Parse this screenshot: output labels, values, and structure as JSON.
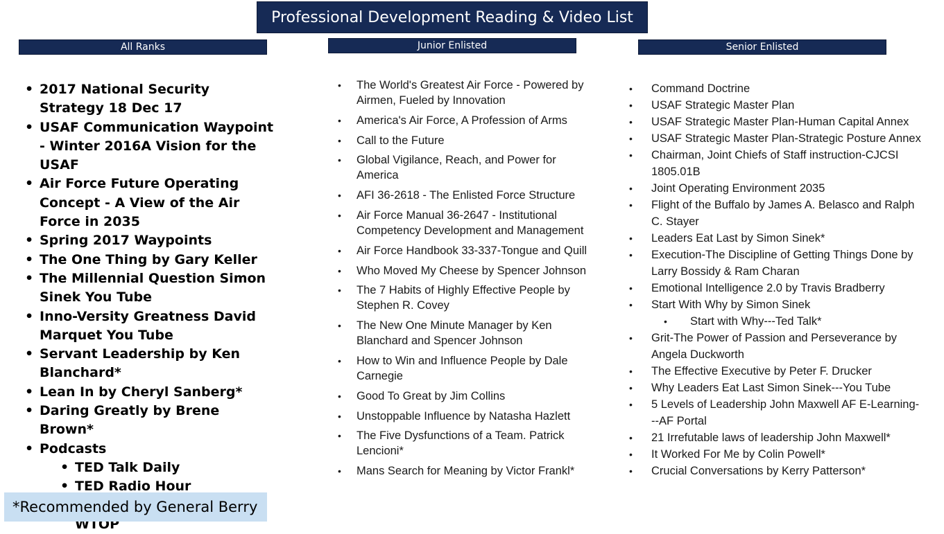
{
  "title": "Professional Development Reading & Video List",
  "columns": {
    "all_ranks": {
      "header": "All Ranks",
      "items": [
        {
          "text": "2017 National Security Strategy 18 Dec 17",
          "level": 1
        },
        {
          "text": "USAF Communication Waypoint - Winter 2016A Vision for the USAF",
          "level": 1
        },
        {
          "text": "Air Force Future Operating Concept  -  A View of the Air Force in 2035",
          "level": 1
        },
        {
          "text": "Spring 2017 Waypoints",
          "level": 1
        },
        {
          "text": "The One Thing by Gary Keller",
          "level": 1
        },
        {
          "text": "The Millennial Question Simon Sinek You Tube",
          "level": 1
        },
        {
          "text": "Inno-Versity Greatness David Marquet You Tube",
          "level": 1
        },
        {
          "text": "Servant Leadership by Ken Blanchard*",
          "level": 1
        },
        {
          "text": "Lean In by Cheryl Sanberg*",
          "level": 1
        },
        {
          "text": "Daring Greatly by Brene Brown*",
          "level": 1
        },
        {
          "text": "Podcasts",
          "level": 1
        },
        {
          "text": "TED Talk Daily",
          "level": 2
        },
        {
          "text": "TED Radio Hour",
          "level": 2
        },
        {
          "text": "Target USA Podcast by WTOP",
          "level": 2
        }
      ]
    },
    "junior_enlisted": {
      "header": "Junior Enlisted",
      "items": [
        {
          "text": "The World's Greatest Air Force - Powered by Airmen, Fueled by Innovation",
          "level": 1
        },
        {
          "text": "America's Air Force, A Profession of Arms",
          "level": 1
        },
        {
          "text": "Call to the Future",
          "level": 1
        },
        {
          "text": "Global Vigilance, Reach, and Power for America",
          "level": 1
        },
        {
          "text": "AFI 36-2618 - The Enlisted Force Structure",
          "level": 1
        },
        {
          "text": "Air Force Manual 36-2647 - Institutional Competency Development and Management",
          "level": 1
        },
        {
          "text": "Air Force Handbook 33-337-Tongue and Quill",
          "level": 1
        },
        {
          "text": "Who Moved My Cheese by Spencer Johnson",
          "level": 1
        },
        {
          "text": "The 7 Habits of Highly Effective People by Stephen R. Covey",
          "level": 1
        },
        {
          "text": "The New One Minute Manager by Ken Blanchard and Spencer Johnson",
          "level": 1
        },
        {
          "text": "How to Win and Influence People by Dale Carnegie",
          "level": 1
        },
        {
          "text": "Good To Great by Jim Collins",
          "level": 1
        },
        {
          "text": "Unstoppable Influence by Natasha Hazlett",
          "level": 1
        },
        {
          "text": "The Five Dysfunctions of a Team. Patrick Lencioni*",
          "level": 1
        },
        {
          "text": "Mans Search for Meaning by Victor Frankl*",
          "level": 1
        }
      ]
    },
    "senior_enlisted": {
      "header": "Senior Enlisted",
      "items": [
        {
          "text": "Command Doctrine",
          "level": 1
        },
        {
          "text": "USAF Strategic Master Plan",
          "level": 1
        },
        {
          "text": " USAF Strategic Master Plan-Human Capital Annex",
          "level": 1
        },
        {
          "text": "USAF  Strategic Master Plan-Strategic Posture Annex",
          "level": 1
        },
        {
          "text": "Chairman, Joint Chiefs of Staff instruction-CJCSI 1805.01B",
          "level": 1
        },
        {
          "text": "Joint Operating Environment 2035",
          "level": 1
        },
        {
          "text": "Flight of the Buffalo by James A. Belasco and Ralph C. Stayer",
          "level": 1
        },
        {
          "text": "Leaders Eat Last by Simon Sinek*",
          "level": 1
        },
        {
          "text": " Execution-The Discipline of Getting Things Done by Larry Bossidy & Ram Charan",
          "level": 1
        },
        {
          "text": "Emotional Intelligence 2.0 by Travis Bradberry",
          "level": 1
        },
        {
          "text": "Start With Why by Simon Sinek",
          "level": 1
        },
        {
          "text": "Start with Why---Ted Talk*",
          "level": 2
        },
        {
          "text": "Grit-The Power of Passion and Perseverance by Angela Duckworth",
          "level": 1
        },
        {
          "text": "The Effective Executive by Peter F. Drucker",
          "level": 1
        },
        {
          "text": "Why Leaders Eat Last Simon Sinek---You Tube",
          "level": 1
        },
        {
          "text": "5 Levels of Leadership John Maxwell AF E-Learning---AF Portal",
          "level": 1
        },
        {
          "text": "21 Irrefutable laws of leadership John Maxwell*",
          "level": 1
        },
        {
          "text": " It Worked For Me by Colin Powell*",
          "level": 1
        },
        {
          "text": "Crucial Conversations by Kerry Patterson*",
          "level": 1
        }
      ]
    }
  },
  "footnote": "*Recommended by General Berry",
  "colors": {
    "header_bg": "#162a55",
    "header_text": "#ffffff",
    "footnote_bg": "#c9dff2"
  }
}
